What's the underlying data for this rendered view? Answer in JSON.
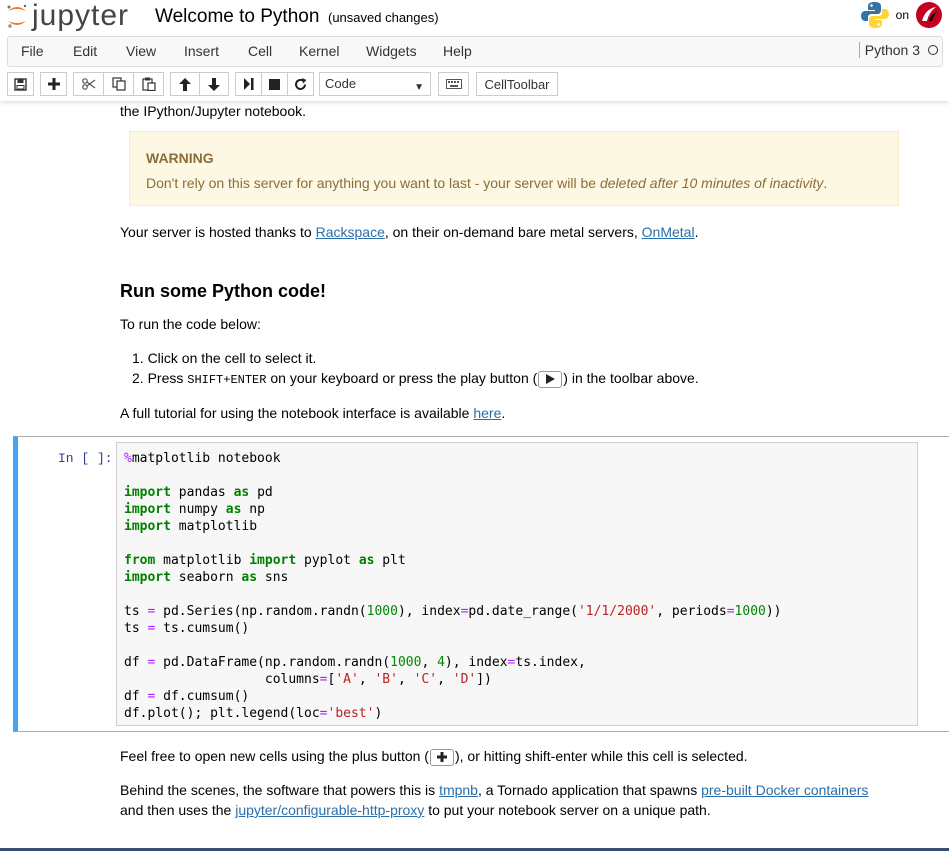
{
  "header": {
    "logo_text": "jupyter",
    "title": "Welcome to Python",
    "save_status": "(unsaved changes)",
    "on_label": "on"
  },
  "menubar": {
    "items": [
      "File",
      "Edit",
      "View",
      "Insert",
      "Cell",
      "Kernel",
      "Widgets",
      "Help"
    ],
    "kernel_name": "Python 3"
  },
  "toolbar": {
    "cell_type": "Code",
    "celltoolbar_label": "CellToolbar",
    "icons": [
      "save-icon",
      "plus-icon",
      "cut-icon",
      "copy-icon",
      "paste-icon",
      "arrow-up-icon",
      "arrow-down-icon",
      "step-forward-icon",
      "stop-icon",
      "restart-icon",
      "keyboard-icon"
    ]
  },
  "notebook": {
    "intro_line": "the IPython/Jupyter notebook.",
    "warning": {
      "title": "WARNING",
      "body_prefix": "Don't rely on this server for anything you want to last - your server will be ",
      "body_emphasis": "deleted after 10 minutes of inactivity",
      "body_suffix": "."
    },
    "hosted": {
      "prefix": "Your server is hosted thanks to ",
      "link1": "Rackspace",
      "middle": ", on their on-demand bare metal servers, ",
      "link2": "OnMetal",
      "suffix": "."
    },
    "heading": "Run some Python code!",
    "to_run": "To run the code below:",
    "steps": {
      "step1": "1. Click on the cell to select it.",
      "step2_prefix": "2. Press ",
      "step2_kbd": "SHIFT+ENTER",
      "step2_middle": " on your keyboard or press the play button (",
      "step2_suffix": ") in the toolbar above."
    },
    "tutorial": {
      "prefix": "A full tutorial for using the notebook interface is available ",
      "link": "here",
      "suffix": "."
    },
    "cell": {
      "prompt": "In [ ]:"
    },
    "feel_free": {
      "prefix": "Feel free to open new cells using the plus button (",
      "suffix": "), or hitting shift-enter while this cell is selected."
    },
    "behind": {
      "prefix": "Behind the scenes, the software that powers this is ",
      "link1": "tmpnb",
      "middle": ", a Tornado application that spawns ",
      "link2": "pre-built Docker containers",
      "line2_prefix": "and then uses the ",
      "link3": "jupyter/configurable-http-proxy",
      "line2_suffix": " to put your notebook server on a unique path."
    }
  },
  "colors": {
    "accent_cell_border": "#42a5f5",
    "warning_bg": "#fcf8e3",
    "warning_text": "#8a6d3b",
    "link": "#296eaa",
    "prompt": "#303f9f",
    "keyword": "#008000",
    "string": "#ba2121",
    "magic": "#aa22ff"
  }
}
